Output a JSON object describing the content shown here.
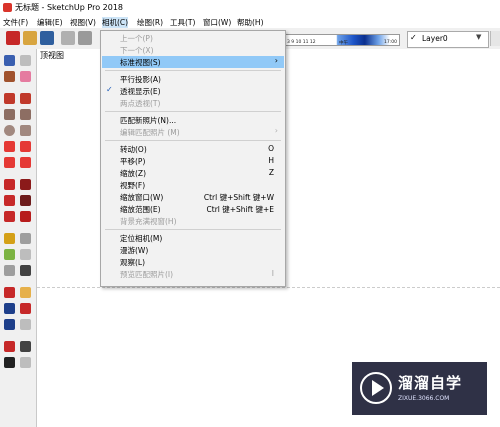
{
  "window": {
    "title": "无标题 - SketchUp Pro 2018"
  },
  "menubar": {
    "items": [
      "文件(F)",
      "编辑(E)",
      "视图(V)",
      "相机(C)",
      "绘图(R)",
      "工具(T)",
      "窗口(W)",
      "帮助(H)"
    ]
  },
  "toolbar": {
    "timeline_labels": [
      "3 9 10 11 12",
      "中午",
      "17:00"
    ],
    "layer": {
      "label": "Layer0"
    }
  },
  "viewport": {
    "label": "顶视图"
  },
  "camera_menu": {
    "items": [
      {
        "label": "上一个(P)",
        "disabled": true
      },
      {
        "label": "下一个(X)",
        "disabled": true
      },
      {
        "label": "标准视图(S)",
        "submenu": true,
        "highlight": true
      },
      {
        "label": "平行投影(A)"
      },
      {
        "label": "透视显示(E)",
        "checked": true
      },
      {
        "label": "两点透视(T)",
        "disabled": true
      },
      {
        "label": "匹配新照片(N)..."
      },
      {
        "label": "编辑匹配照片 (M)",
        "disabled": true,
        "submenu": true
      },
      {
        "label": "转动(O)",
        "shortcut": "O"
      },
      {
        "label": "平移(P)",
        "shortcut": "H"
      },
      {
        "label": "缩放(Z)",
        "shortcut": "Z"
      },
      {
        "label": "视野(F)"
      },
      {
        "label": "缩放窗口(W)",
        "shortcut": "Ctrl 键+Shift 键+W"
      },
      {
        "label": "缩放范围(E)",
        "shortcut": "Ctrl 键+Shift 键+E"
      },
      {
        "label": "背景充满视窗(H)",
        "disabled": true
      },
      {
        "label": "定位相机(M)"
      },
      {
        "label": "漫游(W)"
      },
      {
        "label": "观察(L)"
      },
      {
        "label": "预览匹配照片(I)",
        "shortcut": "I",
        "disabled": true
      }
    ]
  },
  "watermark": {
    "main": "溜溜自学",
    "sub": "ZIXUE.3066.COM"
  },
  "colors": {
    "highlight": "#91c9f7",
    "menu_bg": "#f2f2f2",
    "logo_bg": "#2f3146",
    "toolbar_bg": "#f0f0f0"
  }
}
